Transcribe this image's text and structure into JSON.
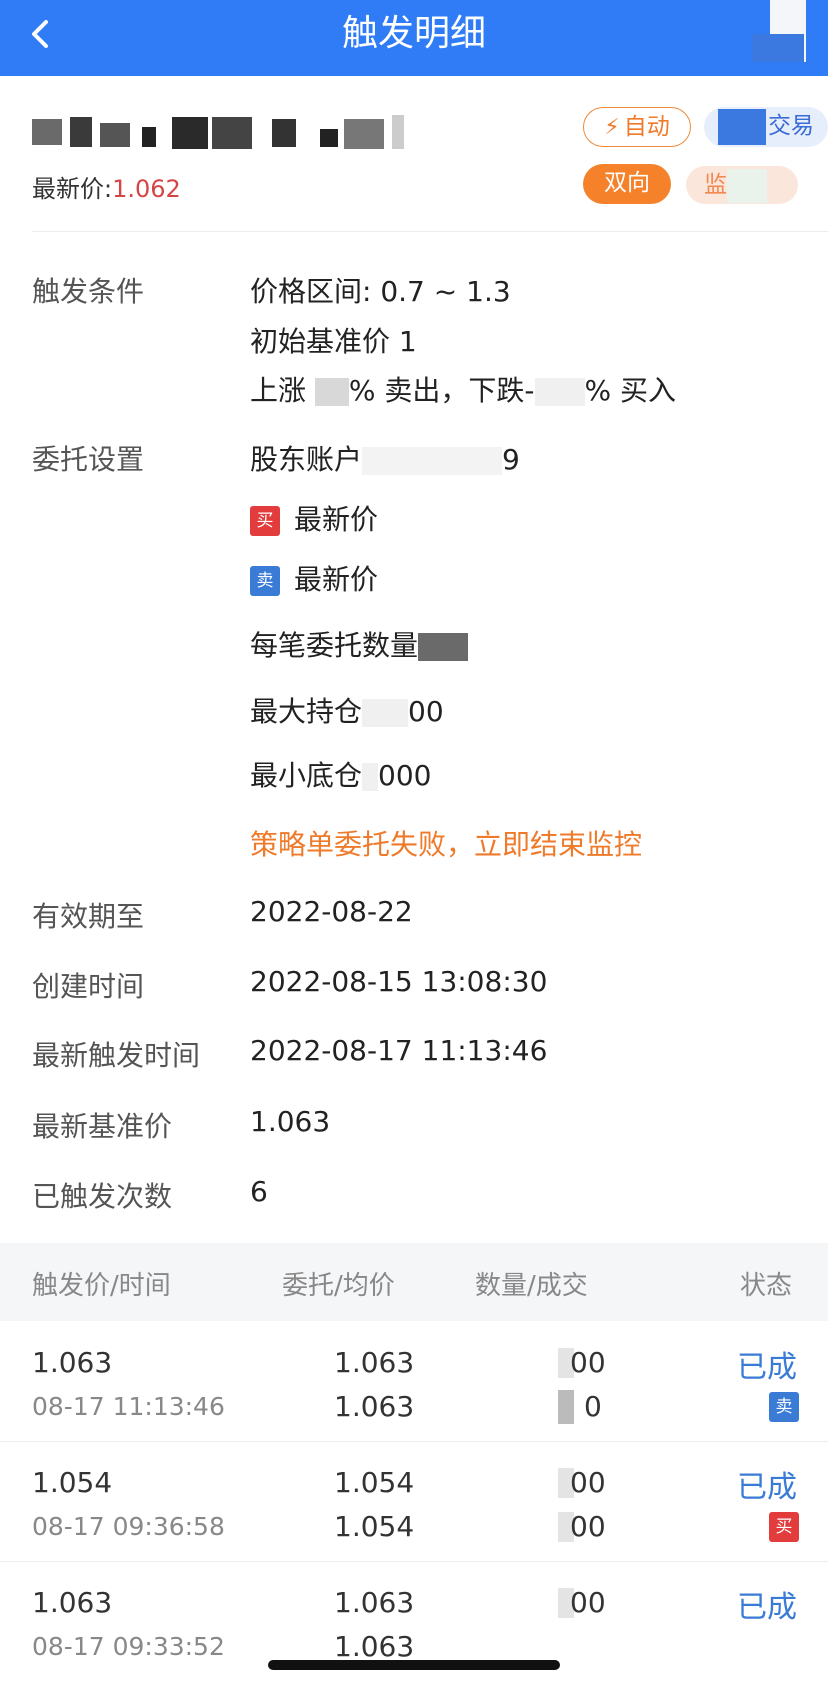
{
  "header": {
    "title": "触发明细",
    "back_icon": "chevron-left-icon"
  },
  "stock": {
    "latest_price_label": "最新价:",
    "latest_price_value": "1.062"
  },
  "tags": {
    "auto": "自动",
    "trade_suffix": "交易",
    "dual": "双向",
    "monitor_prefix": "监"
  },
  "details": {
    "trigger_condition_label": "触发条件",
    "price_range": "价格区间: 0.7 ~ 1.3",
    "initial_base_price": "初始基准价 1",
    "rule_part1": "上涨 ",
    "rule_part2": "% 卖出，下跌-",
    "rule_part3": "% 买入",
    "order_setting_label": "委托设置",
    "account_prefix": "股东账户",
    "account_suffix": "9",
    "buy_badge": "买",
    "buy_price": "最新价",
    "sell_badge": "卖",
    "sell_price": "最新价",
    "qty_per_order": "每笔委托数量",
    "max_position_prefix": "最大持仓",
    "max_position_suffix": "00",
    "min_position_prefix": "最小底仓",
    "min_position_suffix": "000",
    "failure_note": "策略单委托失败，立即结束监控",
    "valid_until_label": "有效期至",
    "valid_until_value": "2022-08-22",
    "created_label": "创建时间",
    "created_value": "2022-08-15 13:08:30",
    "latest_trigger_label": "最新触发时间",
    "latest_trigger_value": "2022-08-17 11:13:46",
    "latest_base_label": "最新基准价",
    "latest_base_value": "1.063",
    "trigger_count_label": "已触发次数",
    "trigger_count_value": "6"
  },
  "table": {
    "columns": [
      "触发价/时间",
      "委托/均价",
      "数量/成交",
      "状态"
    ],
    "rows": [
      {
        "trigger_price": "1.063",
        "time": "08-17 11:13:46",
        "order_price": "1.063",
        "avg_price": "1.063",
        "qty": "00",
        "filled": "0",
        "status": "已成",
        "side": "卖"
      },
      {
        "trigger_price": "1.054",
        "time": "08-17 09:36:58",
        "order_price": "1.054",
        "avg_price": "1.054",
        "qty": "00",
        "filled": "00",
        "status": "已成",
        "side": "买"
      },
      {
        "trigger_price": "1.063",
        "time": "08-17 09:33:52",
        "order_price": "1.063",
        "avg_price": "1.063",
        "qty": "00",
        "filled": "",
        "status": "已成",
        "side": ""
      }
    ]
  },
  "colors": {
    "header_bg": "#2f7cf6",
    "price_red": "#d64545",
    "accent_orange": "#f5822a",
    "status_blue": "#3a7bd5"
  }
}
